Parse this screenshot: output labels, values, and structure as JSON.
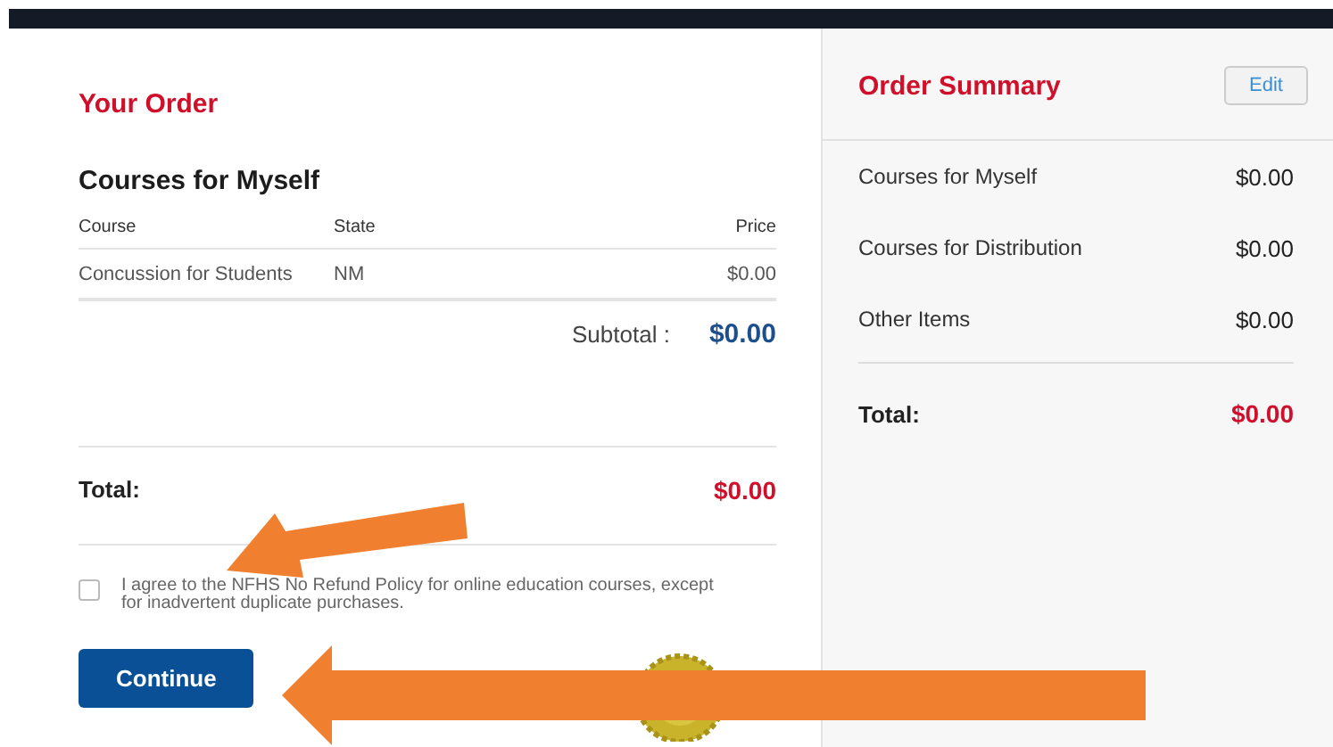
{
  "order": {
    "title": "Your Order",
    "section": "Courses for Myself",
    "columns": [
      "Course",
      "State",
      "Price"
    ],
    "rows": [
      [
        "Concussion for Students",
        "NM",
        "$0.00"
      ]
    ],
    "subtotal_label": "Subtotal :",
    "subtotal": "$0.00",
    "total_label": "Total:",
    "total": "$0.00",
    "agreement": {
      "text": "I agree to the NFHS No Refund Policy for online education courses, except for inadvertent duplicate purchases.",
      "checked": false
    },
    "continue_button": "Continue"
  },
  "summary": {
    "title": "Order Summary",
    "edit_button": "Edit",
    "items": [
      {
        "label": "Courses for Myself",
        "amount": "$0.00"
      },
      {
        "label": "Courses for Distribution",
        "amount": "$0.00"
      },
      {
        "label": "Other Items",
        "amount": "$0.00"
      }
    ],
    "total_label": "Total:",
    "total": "$0.00"
  }
}
